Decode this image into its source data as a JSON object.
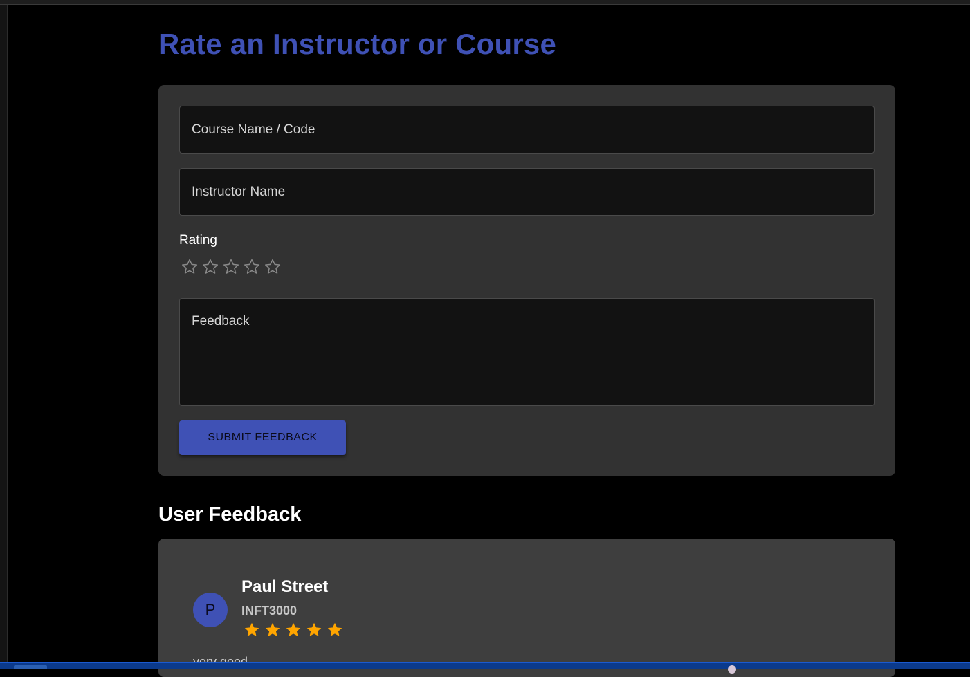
{
  "page": {
    "title": "Rate an Instructor or Course",
    "accent_color": "#3f51b5",
    "background_color": "#000000"
  },
  "form": {
    "course_placeholder": "Course Name / Code",
    "instructor_placeholder": "Instructor Name",
    "rating_label": "Rating",
    "rating_value": 0,
    "rating_max": 5,
    "empty_star_icon": "star-outline-icon",
    "feedback_placeholder": "Feedback",
    "submit_label": "SUBMIT FEEDBACK"
  },
  "feedback_section": {
    "title": "User Feedback",
    "items": [
      {
        "avatar_letter": "P",
        "name": "Paul Street",
        "course": "INFT3000",
        "rating": 5,
        "star_color": "#ffa500",
        "comment": "very good"
      }
    ]
  }
}
